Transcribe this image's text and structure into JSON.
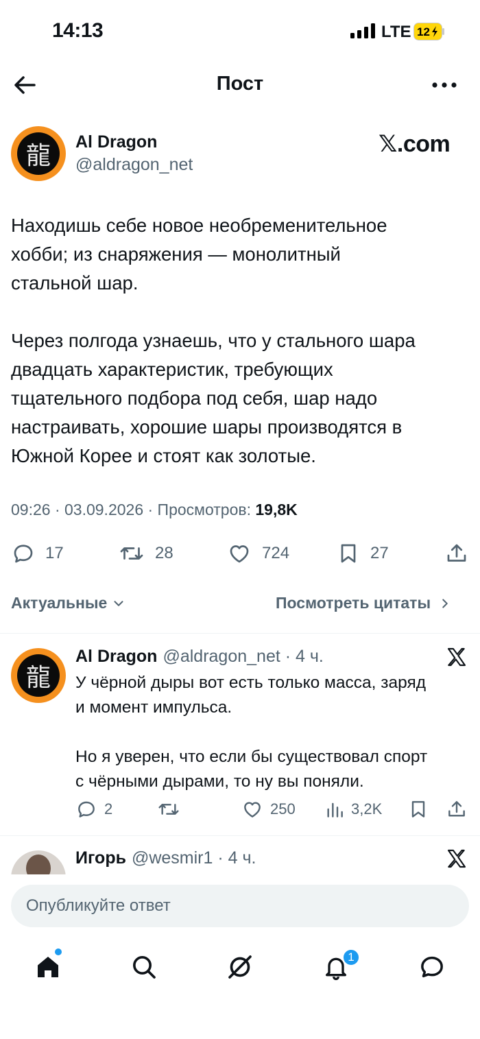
{
  "status_bar": {
    "time": "14:13",
    "network": "LTE",
    "battery": "12"
  },
  "nav": {
    "title": "Пост",
    "back_icon": "arrow-left-icon",
    "more_icon": "more-horizontal-icon"
  },
  "post": {
    "author_name": "Al Dragon",
    "author_handle": "@aldragon_net",
    "avatar_glyph": "龍",
    "site_label": "𝕏.com",
    "text": "Находишь себе новое необременительное\nхобби; из снаряжения — монолитный\nстальной шар.\n\nЧерез полгода узнаешь, что у стального шара\nдвадцать характеристик, требующих\nтщательного подбора под себя, шар надо\nнастраивать, хорошие шары производятся в\nЮжной Корее и стоят как золотые.",
    "meta": "09:26 · 03.09.2026 · Просмотров: ",
    "views": "19,8K",
    "actions": {
      "replies": "17",
      "reposts": "28",
      "likes": "724",
      "bookmarks": "27"
    }
  },
  "filters": {
    "sort_label": "Актуальные",
    "quotes_label": "Посмотреть цитаты"
  },
  "replies": [
    {
      "name": "Al Dragon",
      "meta": "@aldragon_net · 4 ч.",
      "avatar_glyph": "龍",
      "text": "У чёрной дыры вот есть только масса, заряд\nи момент импульса.\n\nНо я уверен, что если бы существовал спорт\nс чёрными дырами, то ну вы поняли.",
      "actions": {
        "replies": "2",
        "reposts": "",
        "likes": "250",
        "views": "3,2K"
      }
    },
    {
      "name": "Игорь",
      "meta": "@wesmir1 · 4 ч."
    }
  ],
  "reply_composer": {
    "placeholder": "Опубликуйте ответ"
  },
  "tabbar": {
    "notifications_count": "1"
  },
  "colors": {
    "accent": "#1d9bf0",
    "muted": "#536471",
    "avatar_ring": "#f5901e"
  }
}
